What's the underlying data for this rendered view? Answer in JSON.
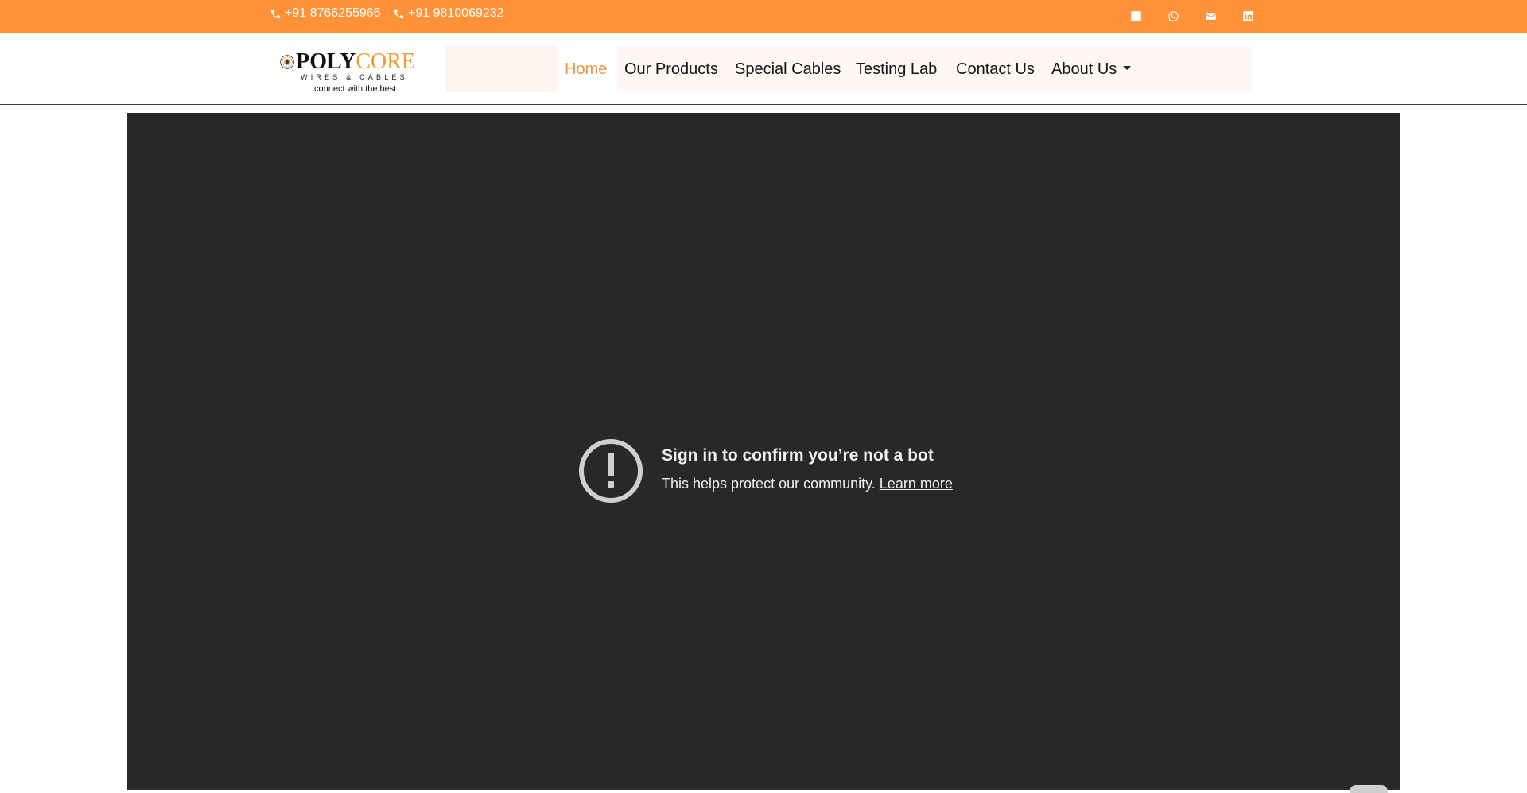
{
  "topbar": {
    "phones": [
      "+91 8766255966",
      "+91 9810069232"
    ],
    "social_icons": [
      "phone-icon",
      "whatsapp-icon",
      "email-icon",
      "linkedin-icon"
    ],
    "background": "#ff9139"
  },
  "logo": {
    "brand_a": "POLY",
    "brand_b": "CORE",
    "sub": "WIRES & CABLES",
    "tagline": "connect with the best"
  },
  "nav": {
    "items": [
      "Home",
      "Our Products",
      "Special Cables",
      "Testing Lab",
      "Contact Us",
      "About Us"
    ],
    "active": "Home",
    "active_color": "#f0954a"
  },
  "video": {
    "background": "#282828",
    "title": "Sign in to confirm you’re not a bot",
    "body": "This helps protect our community.",
    "link": "Learn more",
    "icon": "alert-circle-icon"
  }
}
